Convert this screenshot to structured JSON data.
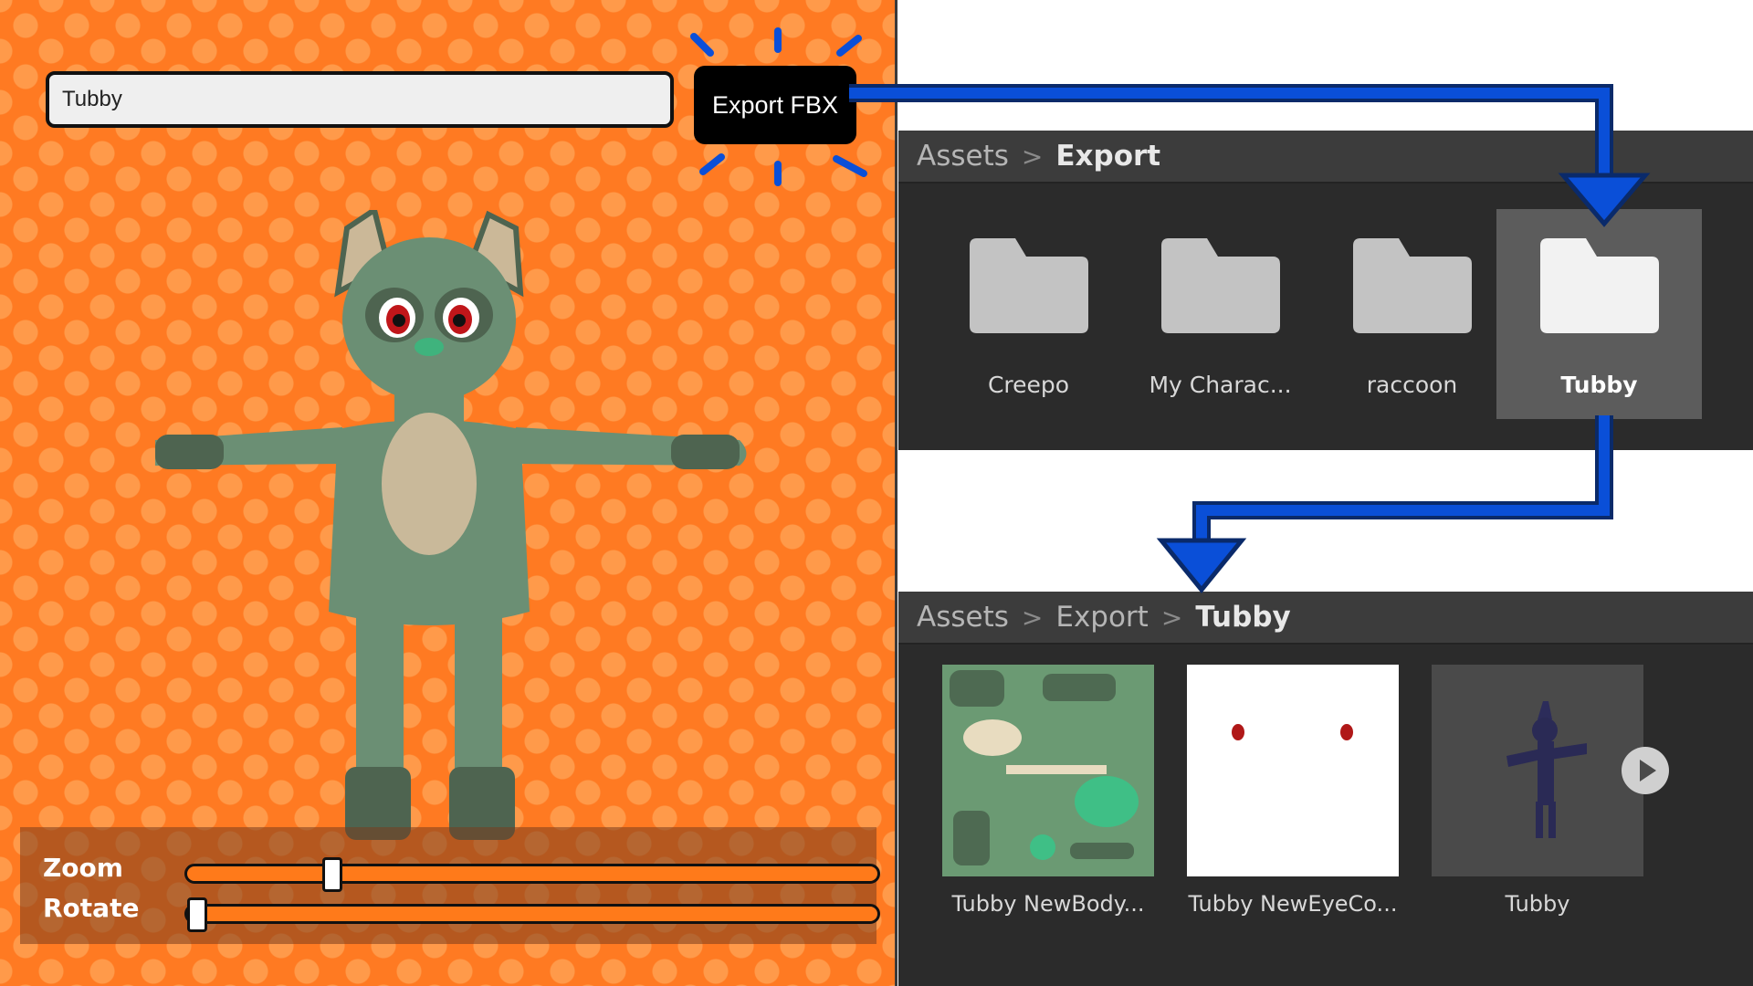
{
  "editor": {
    "name_value": "Tubby",
    "export_label": "Export FBX",
    "zoom_label": "Zoom",
    "rotate_label": "Rotate",
    "zoom_level": 0.2,
    "rotate_level": 0.0,
    "background_color": "#ff7a22",
    "character_colors": {
      "body": "#6b8f74",
      "belly": "#c9b99a",
      "dark": "#4e6450",
      "nose": "#3fb37d",
      "eye": "#c0161a"
    }
  },
  "project_top": {
    "breadcrumb": [
      "Assets",
      "Export"
    ],
    "folders": [
      {
        "label": "Creepo",
        "icon": "folder-icon",
        "selected": false
      },
      {
        "label": "My Charac...",
        "icon": "folder-icon",
        "selected": false
      },
      {
        "label": "raccoon",
        "icon": "folder-icon",
        "selected": false
      },
      {
        "label": "Tubby",
        "icon": "folder-icon",
        "selected": true
      }
    ]
  },
  "project_bottom": {
    "breadcrumb": [
      "Assets",
      "Export",
      "Tubby"
    ],
    "assets": [
      {
        "label": "Tubby NewBody...",
        "kind": "texture",
        "icon": "body-texture-thumbnail"
      },
      {
        "label": "Tubby NewEyeCo...",
        "kind": "texture",
        "icon": "eye-texture-thumbnail"
      },
      {
        "label": "Tubby",
        "kind": "model",
        "icon": "model-thumbnail"
      }
    ]
  },
  "arrow_color": "#0a4fd8",
  "sparkle_color": "#0a4fd8"
}
